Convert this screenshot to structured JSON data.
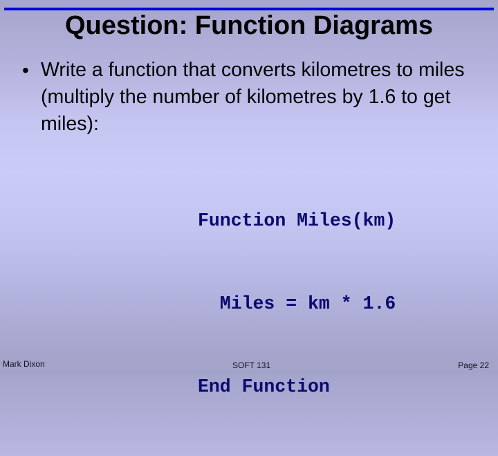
{
  "slide": {
    "title": "Question: Function Diagrams",
    "accent_color": "#0000e0",
    "bullets": [
      {
        "icon": "bullet-dot-icon",
        "glyph": "•",
        "text": "Write a function that converts kilometres to miles (multiply the number of kilometres by 1.6 to get miles):"
      }
    ],
    "code": {
      "lines": [
        "Function Miles(km)",
        "  Miles = km * 1.6",
        "End Function"
      ]
    },
    "footer": {
      "author": "Mark Dixon",
      "course": "SOFT 131",
      "page": "Page 22"
    }
  }
}
